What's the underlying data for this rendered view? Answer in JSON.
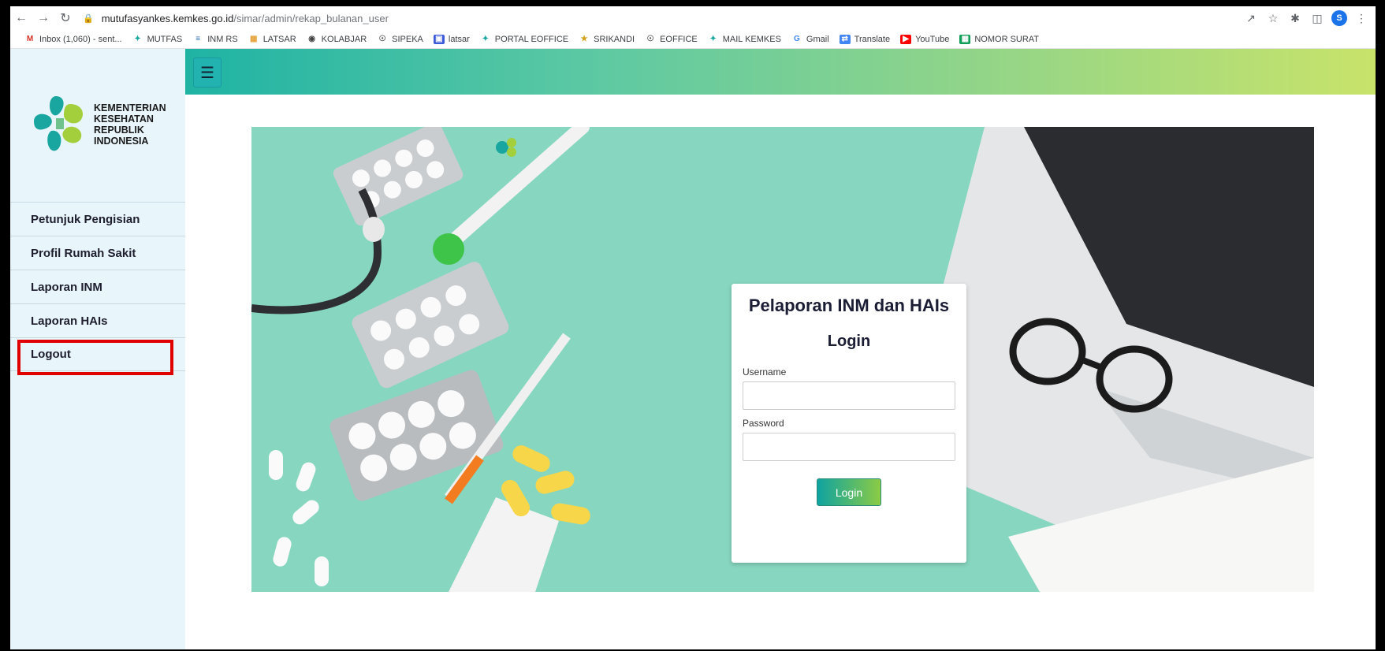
{
  "browser": {
    "url_host": "mutufasyankes.kemkes.go.id",
    "url_path": "/simar/admin/rekap_bulanan_user",
    "profile_initial": "S",
    "bookmarks": [
      {
        "label": "Inbox (1,060) - sent...",
        "icon": "gmail-icon"
      },
      {
        "label": "MUTFAS",
        "icon": "kemkes-icon"
      },
      {
        "label": "INM RS",
        "icon": "inm-icon"
      },
      {
        "label": "LATSAR",
        "icon": "grid-icon"
      },
      {
        "label": "KOLABJAR",
        "icon": "kolabjar-icon"
      },
      {
        "label": "SIPEKA",
        "icon": "globe-icon"
      },
      {
        "label": "latsar",
        "icon": "calendar-icon"
      },
      {
        "label": "PORTAL EOFFICE",
        "icon": "kemkes-icon"
      },
      {
        "label": "SRIKANDI",
        "icon": "srikandi-icon"
      },
      {
        "label": "EOFFICE",
        "icon": "globe-icon"
      },
      {
        "label": "MAIL KEMKES",
        "icon": "kemkes-icon"
      },
      {
        "label": "Gmail",
        "icon": "google-icon"
      },
      {
        "label": "Translate",
        "icon": "translate-icon"
      },
      {
        "label": "YouTube",
        "icon": "youtube-icon"
      },
      {
        "label": "NOMOR SURAT",
        "icon": "sheets-icon"
      }
    ]
  },
  "sidebar": {
    "logo_lines": [
      "KEMENTERIAN",
      "KESEHATAN",
      "REPUBLIK",
      "INDONESIA"
    ],
    "menu": [
      "Petunjuk Pengisian",
      "Profil Rumah Sakit",
      "Laporan INM",
      "Laporan HAIs",
      "Logout"
    ]
  },
  "topbar": {
    "menu_icon": "☰"
  },
  "login": {
    "title": "Pelaporan INM dan HAIs",
    "subtitle": "Login",
    "username_label": "Username",
    "password_label": "Password",
    "button_label": "Login"
  },
  "colors": {
    "highlight": "#e00000",
    "sidebar_bg": "#e8f5fb",
    "hero_bg": "#87d6bf"
  }
}
